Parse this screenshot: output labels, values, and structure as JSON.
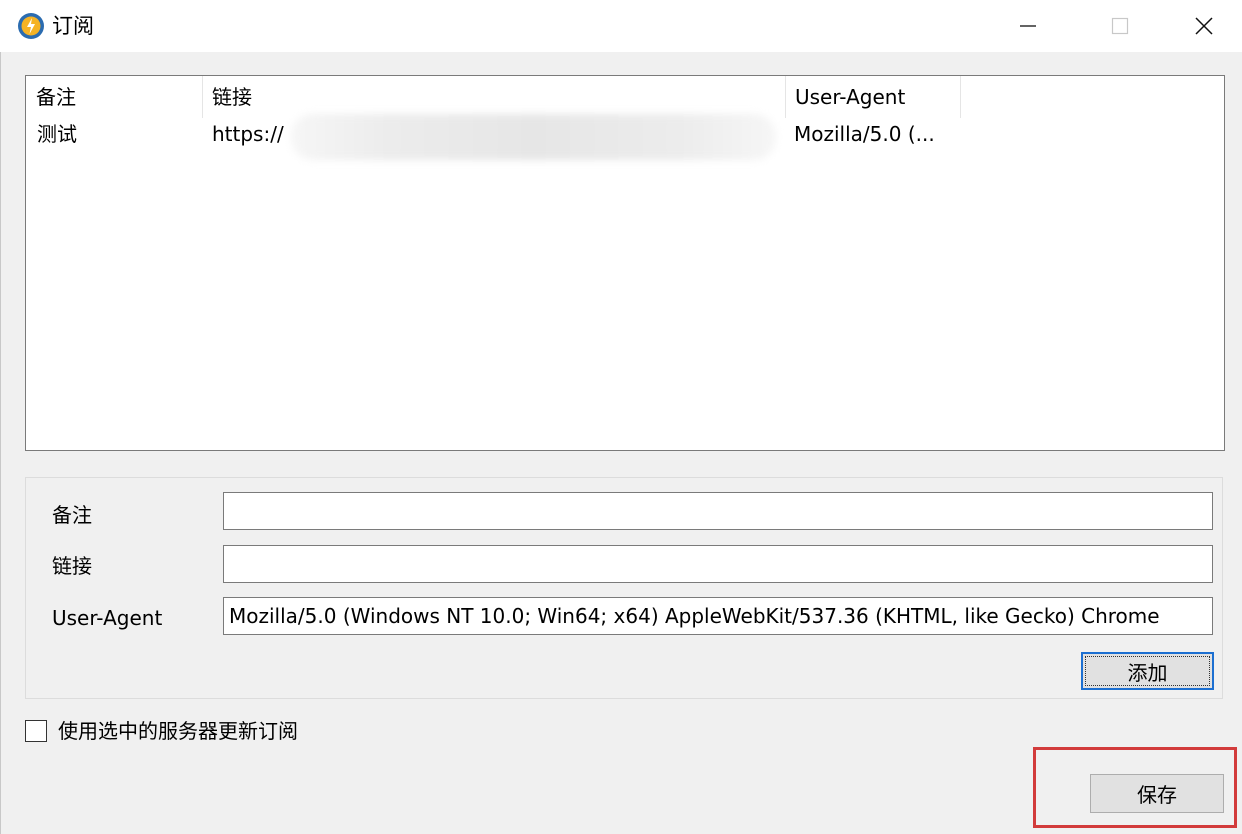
{
  "window": {
    "title": "订阅",
    "icon": "app-logo-icon"
  },
  "controls": {
    "minimize": "minimize-icon",
    "maximize": "maximize-icon",
    "close": "close-icon"
  },
  "list": {
    "columns": [
      "备注",
      "链接",
      "User-Agent"
    ],
    "rows": [
      {
        "note": "测试",
        "link": "https://",
        "user_agent": "Mozilla/5.0 (..."
      }
    ]
  },
  "form": {
    "note_label": "备注",
    "note_value": "",
    "link_label": "链接",
    "link_value": "",
    "ua_label": "User-Agent",
    "ua_value": "Mozilla/5.0 (Windows NT 10.0; Win64; x64) AppleWebKit/537.36 (KHTML, like Gecko) Chrome",
    "add_button": "添加"
  },
  "options": {
    "update_with_selected_server": "使用选中的服务器更新订阅",
    "checked": false
  },
  "footer": {
    "save_button": "保存"
  },
  "colors": {
    "highlight": "#d23b3b",
    "focus": "#1c6fd1"
  }
}
